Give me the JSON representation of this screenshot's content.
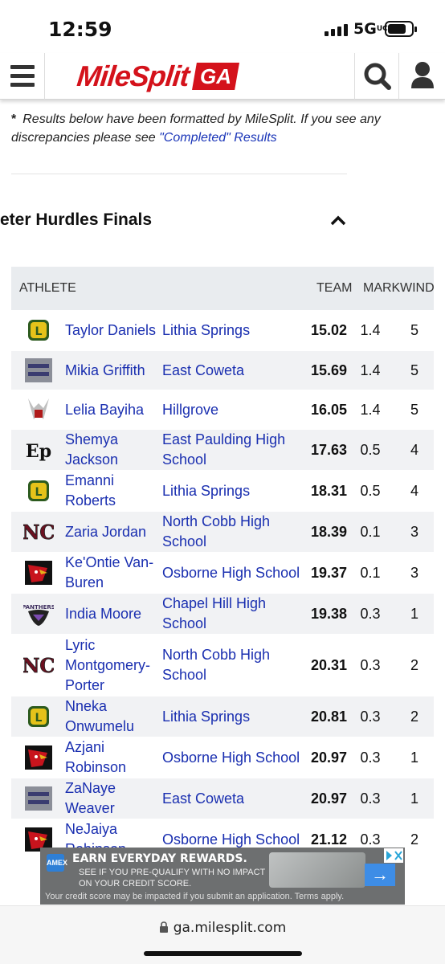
{
  "status_bar": {
    "time": "12:59",
    "network": "5G",
    "network_suffix": "UC"
  },
  "nav": {
    "logo_text": "MileSplit",
    "logo_state": "GA"
  },
  "note": {
    "star": "*",
    "text": "Results below have been formatted by MileSplit. If you see any discrepancies please see ",
    "link": "\"Completed\" Results"
  },
  "event": {
    "title": "eter Hurdles Finals"
  },
  "table": {
    "headers": {
      "athlete": "ATHLETE",
      "team": "TEAM",
      "mark": "MARK",
      "wind": "WIND"
    },
    "rows": [
      {
        "logo": "lithia-springs-logo",
        "athlete": "Taylor Daniels",
        "team": "Lithia Springs",
        "mark": "15.02",
        "wind": "1.4",
        "place": "5"
      },
      {
        "logo": "east-coweta-logo",
        "athlete": "Mikia Griffith",
        "team": "East Coweta",
        "mark": "15.69",
        "wind": "1.4",
        "place": "5"
      },
      {
        "logo": "hillgrove-logo",
        "athlete": "Lelia Bayiha",
        "team": "Hillgrove",
        "mark": "16.05",
        "wind": "1.4",
        "place": "5"
      },
      {
        "logo": "east-paulding-logo",
        "athlete": "Shemya Jackson",
        "team": "East Paulding High School",
        "mark": "17.63",
        "wind": "0.5",
        "place": "4"
      },
      {
        "logo": "lithia-springs-logo",
        "athlete": "Emanni Roberts",
        "team": "Lithia Springs",
        "mark": "18.31",
        "wind": "0.5",
        "place": "4"
      },
      {
        "logo": "north-cobb-logo",
        "athlete": "Zaria Jordan",
        "team": "North Cobb High School",
        "mark": "18.39",
        "wind": "0.1",
        "place": "3"
      },
      {
        "logo": "osborne-logo",
        "athlete": "Ke'Ontie Van-Buren",
        "team": "Osborne High School",
        "mark": "19.37",
        "wind": "0.1",
        "place": "3"
      },
      {
        "logo": "chapel-hill-logo",
        "athlete": "India Moore",
        "team": "Chapel Hill High School",
        "mark": "19.38",
        "wind": "0.3",
        "place": "1"
      },
      {
        "logo": "north-cobb-logo",
        "athlete": "Lyric Montgomery-Porter",
        "team": "North Cobb High School",
        "mark": "20.31",
        "wind": "0.3",
        "place": "2"
      },
      {
        "logo": "lithia-springs-logo",
        "athlete": "Nneka Onwumelu",
        "team": "Lithia Springs",
        "mark": "20.81",
        "wind": "0.3",
        "place": "2"
      },
      {
        "logo": "osborne-logo",
        "athlete": "Azjani Robinson",
        "team": "Osborne High School",
        "mark": "20.97",
        "wind": "0.3",
        "place": "1"
      },
      {
        "logo": "east-coweta-logo",
        "athlete": "ZaNaye Weaver",
        "team": "East Coweta",
        "mark": "20.97",
        "wind": "0.3",
        "place": "1"
      },
      {
        "logo": "osborne-logo",
        "athlete": "NeJaiya Robinson",
        "team": "Osborne High School",
        "mark": "21.12",
        "wind": "0.3",
        "place": "2"
      }
    ]
  },
  "ad": {
    "badge": "AMEX",
    "headline": "EARN EVERYDAY REWARDS.",
    "body": "SEE IF YOU PRE-QUALIFY WITH NO IMPACT ON YOUR CREDIT SCORE.",
    "disclaimer": "Your credit score may be impacted if you submit an application. Terms apply.",
    "arrow": "→"
  },
  "browser": {
    "url": "ga.milesplit.com"
  }
}
